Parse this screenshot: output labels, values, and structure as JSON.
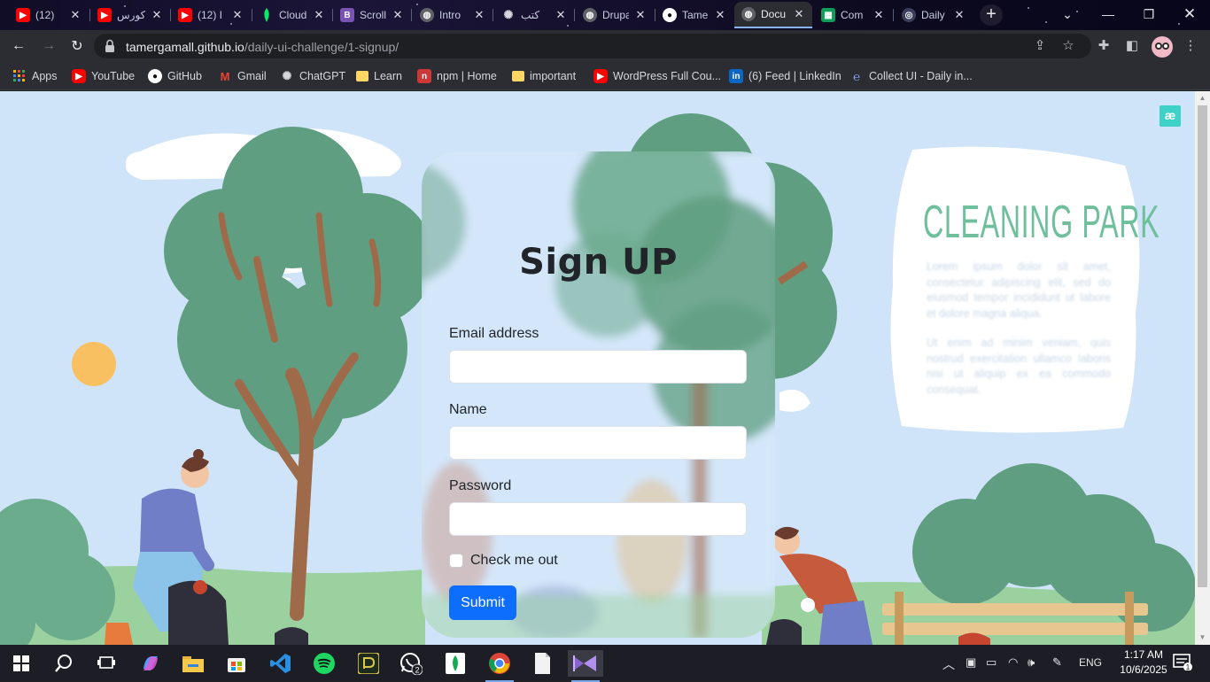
{
  "browser": {
    "tabs": [
      {
        "title": "(12)",
        "icon": "youtube-icon",
        "color": "#ff0000"
      },
      {
        "title": "كورس",
        "icon": "youtube-icon",
        "color": "#ff0000"
      },
      {
        "title": "(12) I",
        "icon": "youtube-icon",
        "color": "#ff0000"
      },
      {
        "title": "Cloud",
        "icon": "mongodb-icon",
        "color": "#00ed64"
      },
      {
        "title": "Scroll",
        "icon": "bootstrap-icon",
        "color": "#7952b3"
      },
      {
        "title": "Intro",
        "icon": "globe-icon",
        "color": "#9aa0a6"
      },
      {
        "title": "كتب",
        "icon": "openai-icon",
        "color": "#d5d7dc"
      },
      {
        "title": "Drupal",
        "icon": "globe-icon",
        "color": "#9aa0a6"
      },
      {
        "title": "Tamer",
        "icon": "github-icon",
        "color": "#ffffff"
      },
      {
        "title": "Docu",
        "icon": "globe-icon",
        "color": "#9aa0a6"
      },
      {
        "title": "Com",
        "icon": "sheets-icon",
        "color": "#0f9d58"
      },
      {
        "title": "Daily",
        "icon": "dribbble-icon",
        "color": "#3b3f5c"
      }
    ],
    "active_tab_index": 9,
    "url_domain": "tamergamall.github.io",
    "url_path": "/daily-ui-challenge/1-signup/",
    "bookmarks": [
      {
        "label": "Apps",
        "icon": "apps-grid-icon",
        "color": "#f4b400"
      },
      {
        "label": "YouTube",
        "icon": "youtube-icon",
        "color": "#ff0000"
      },
      {
        "label": "GitHub",
        "icon": "github-icon",
        "color": "#ffffff"
      },
      {
        "label": "Gmail",
        "icon": "gmail-icon",
        "color": "#ea4335"
      },
      {
        "label": "ChatGPT",
        "icon": "openai-icon",
        "color": "#d5d7dc"
      },
      {
        "label": "Learn",
        "icon": "folder-icon",
        "color": "#fdd663"
      },
      {
        "label": "npm | Home",
        "icon": "npm-icon",
        "color": "#cb3837"
      },
      {
        "label": "important",
        "icon": "folder-icon",
        "color": "#fdd663"
      },
      {
        "label": "WordPress Full Cou...",
        "icon": "youtube-icon",
        "color": "#ff0000"
      },
      {
        "label": "(6) Feed | LinkedIn",
        "icon": "linkedin-icon",
        "color": "#0a66c2"
      },
      {
        "label": "Collect UI - Daily in...",
        "icon": "collectui-icon",
        "color": "#5f7dd6"
      }
    ]
  },
  "page": {
    "badge": "æ",
    "form": {
      "title": "Sign UP",
      "email_label": "Email address",
      "name_label": "Name",
      "password_label": "Password",
      "checkbox_label": "Check me out",
      "submit_label": "Submit",
      "submit_color": "#0d6efd"
    },
    "poster": {
      "title": "CLEANING PARK",
      "paragraph_1": "Lorem ipsum dolor sit amet, consectetur adipiscing elit, sed do eiusmod tempor incididunt ut labore et dolore magna aliqua.",
      "paragraph_2": "Ut enim ad minim veniam, quis nostrud exercitation ullamco laboris nisi ut aliquip ex ea commodo consequat."
    }
  },
  "taskbar": {
    "apps": [
      "start-icon",
      "search-icon",
      "task-view-icon",
      "copilot-icon",
      "file-explorer-icon",
      "store-icon",
      "vscode-icon",
      "spotify-icon",
      "app-icon",
      "whatsapp-icon",
      "mongodb-compass-icon",
      "chrome-icon",
      "notepad-icon",
      "visual-studio-icon"
    ],
    "whatsapp_badge": "2",
    "language": "ENG",
    "time": "1:17 AM",
    "date": "10/6/2025",
    "notification_count": "1"
  }
}
